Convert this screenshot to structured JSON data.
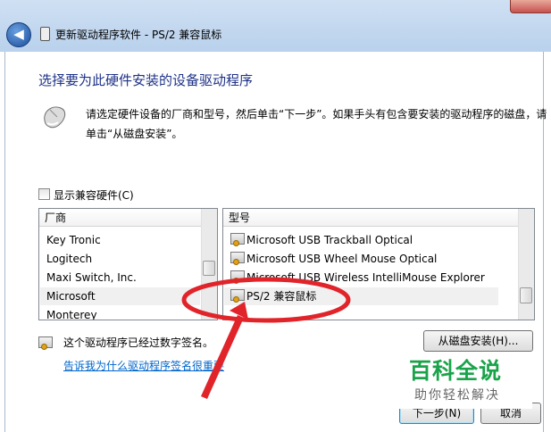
{
  "window": {
    "title": "更新驱动程序软件 - PS/2 兼容鼠标",
    "back_glyph": "◀"
  },
  "main": {
    "heading": "选择要为此硬件安装的设备驱动程序",
    "description": "请选定硬件设备的厂商和型号，然后单击“下一步”。如果手头有包含要安装的驱动程序的磁盘，请单击“从磁盘安装”。",
    "show_compatible_label": "显示兼容硬件(C)",
    "show_compatible_checked": false
  },
  "manufacturers": {
    "header": "厂商",
    "items": [
      "Key Tronic",
      "Logitech",
      "Maxi Switch, Inc.",
      "Microsoft",
      "Monterey"
    ],
    "selected": "Microsoft"
  },
  "models": {
    "header": "型号",
    "items": [
      "Microsoft USB Trackball Optical",
      "Microsoft USB Wheel Mouse Optical",
      "Microsoft USB Wireless IntelliMouse Explorer",
      "PS/2 兼容鼠标"
    ],
    "selected": "PS/2 兼容鼠标"
  },
  "signature": {
    "text": "这个驱动程序已经过数字签名。",
    "link": "告诉我为什么驱动程序签名很重要"
  },
  "buttons": {
    "have_disk": "从磁盘安装(H)...",
    "next": "下一步(N)",
    "cancel": "取消"
  },
  "watermark": {
    "title": "百科全说",
    "subtitle": "助你轻松解决"
  },
  "colors": {
    "heading": "#1e3287",
    "link": "#0066cc",
    "annotation": "#e0242a",
    "watermark": "#1aa34a"
  }
}
